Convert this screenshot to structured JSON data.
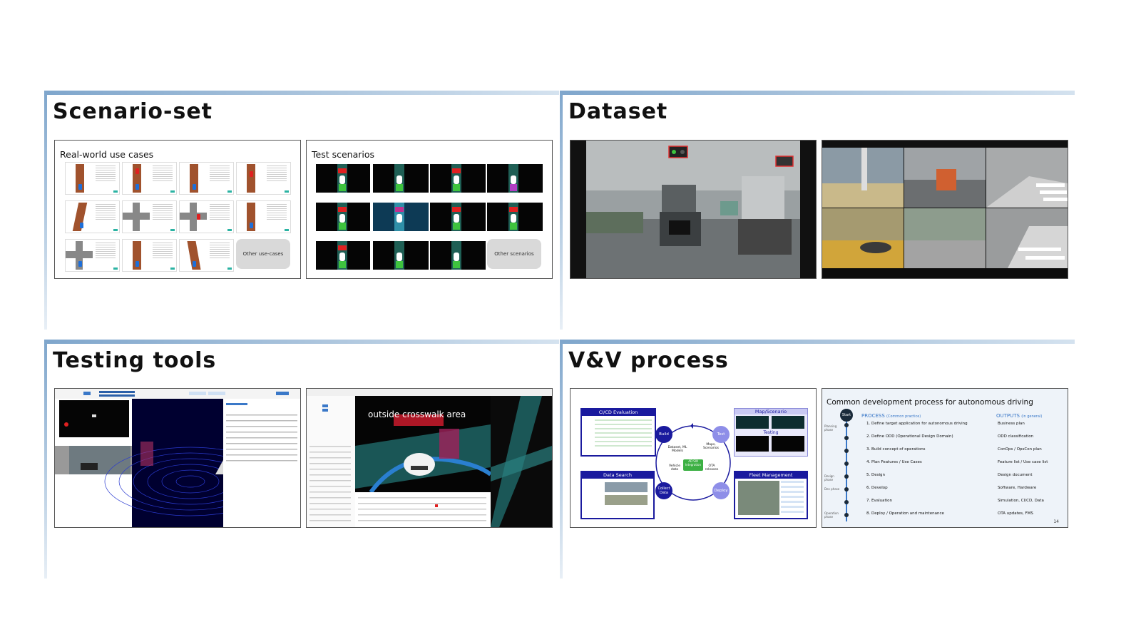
{
  "quadrants": {
    "scenario": {
      "title": "Scenario-set"
    },
    "dataset": {
      "title": "Dataset"
    },
    "testing": {
      "title": "Testing tools"
    },
    "vv": {
      "title": "V&V process"
    }
  },
  "scenario_cards": {
    "real_world": {
      "label": "Real-world use cases",
      "other": "Other use-cases"
    },
    "test": {
      "label": "Test scenarios",
      "other": "Other scenarios"
    }
  },
  "testing_cards": {
    "sim_overlay": "outside crosswalk area"
  },
  "vv_cards": {
    "cicd": {
      "ci_eval": "CI/CD Evaluation",
      "map_scenario": "Map/Scenario",
      "testing": "Testing",
      "data_search": "Data Search",
      "fleet": "Fleet Management",
      "build": "Build",
      "test": "Test",
      "collect": "Collect Data",
      "deploy": "Deploy",
      "dataset_ml": "Dataset, ML Models",
      "maps": "Maps, Scenarios",
      "vehicle": "Vehicle data",
      "ota": "OTA releases",
      "ad_sw": "AD SW Integration"
    },
    "process": {
      "title": "Common development process for autonomous driving",
      "start": "Start",
      "process_head": "PROCESS",
      "process_sub": "(Common practice)",
      "outputs_head": "OUTPUTS",
      "outputs_sub": "(in general)",
      "page": "14",
      "steps": [
        {
          "label": "1. Define target application for autonomous driving",
          "output": "Business plan"
        },
        {
          "label": "2. Define ODD (Operational Design Domain)",
          "output": "ODD classification"
        },
        {
          "label": "3. Build concept of operations",
          "output": "ConOps / OpsCon plan"
        },
        {
          "label": "4. Plan Features / Use Cases",
          "output": "Feature list / Use case list"
        },
        {
          "label": "5. Design",
          "output": "Design document"
        },
        {
          "label": "6. Develop",
          "output": "Software, Hardware"
        },
        {
          "label": "7. Evaluation",
          "output": "Simulation, CI/CD, Data"
        },
        {
          "label": "8. Deploy / Operation and maintenance",
          "output": "OTA updates, FMS"
        }
      ],
      "phases": [
        "Planning phase",
        "Design phase",
        "Dev phase",
        "Operation phase"
      ]
    }
  },
  "colors": {
    "accent": "#7fa6cc",
    "navy": "#1a1a9e",
    "process_blue": "#3a78c8"
  }
}
